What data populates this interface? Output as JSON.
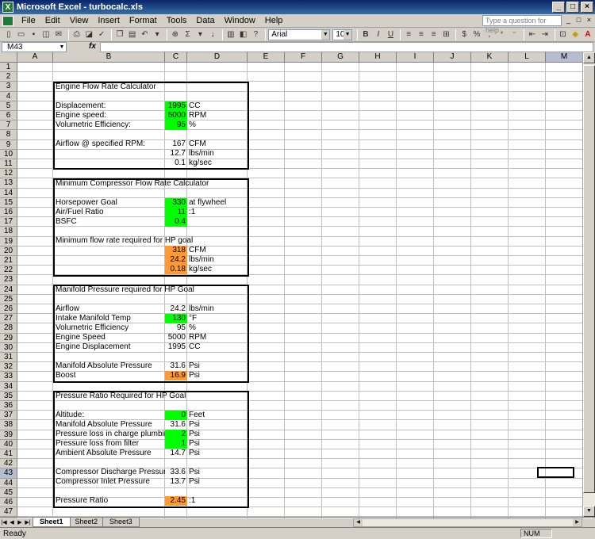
{
  "window": {
    "title": "Microsoft Excel - turbocalc.xls"
  },
  "menu": [
    "File",
    "Edit",
    "View",
    "Insert",
    "Format",
    "Tools",
    "Data",
    "Window",
    "Help"
  ],
  "help_placeholder": "Type a question for help",
  "toolbar": {
    "font_name": "Arial",
    "font_size": "10"
  },
  "namebox": "M43",
  "fx_label": "fx",
  "columns": [
    "A",
    "B",
    "C",
    "D",
    "E",
    "F",
    "G",
    "H",
    "I",
    "J",
    "K",
    "L",
    "M"
  ],
  "selected_column": "M",
  "selected_row": 43,
  "rows": [
    1,
    2,
    3,
    4,
    5,
    6,
    7,
    8,
    9,
    10,
    11,
    12,
    13,
    14,
    15,
    16,
    17,
    18,
    19,
    20,
    21,
    22,
    23,
    24,
    25,
    26,
    27,
    28,
    29,
    30,
    31,
    32,
    33,
    34,
    35,
    36,
    37,
    38,
    39,
    40,
    41,
    42,
    43,
    44,
    45,
    46,
    47
  ],
  "sections": {
    "engine": {
      "title": "Engine Flow Rate Calculator",
      "displacement": {
        "label": "Displacement:",
        "value": "1995",
        "unit": "CC"
      },
      "speed": {
        "label": "Engine speed:",
        "value": "5000",
        "unit": "RPM"
      },
      "ve": {
        "label": "Volumetric Efficiency:",
        "value": "95",
        "unit": "%"
      },
      "airflow": {
        "label": "Airflow  @ specified RPM:",
        "value": "167",
        "unit": "CFM"
      },
      "airflow_lbs": {
        "value": "12.7",
        "unit": "lbs/min"
      },
      "airflow_kg": {
        "value": "0.1",
        "unit": "kg/sec"
      }
    },
    "compressor": {
      "title": "Minimum Compressor Flow Rate Calculator",
      "hp_goal": {
        "label": "Horsepower Goal",
        "value": "330",
        "unit": "at flywheel"
      },
      "afr": {
        "label": "Air/Fuel Ratio",
        "value": "11",
        "unit": ":1"
      },
      "bsfc": {
        "label": "BSFC",
        "value": "0.4"
      },
      "min_flow_label": "Minimum flow rate required for HP goal",
      "cfm": {
        "value": "318",
        "unit": "CFM"
      },
      "lbs": {
        "value": "24.2",
        "unit": "lbs/min"
      },
      "kg": {
        "value": "0.18",
        "unit": "kg/sec"
      }
    },
    "manifold": {
      "title": "Manifold Pressure required for HP Goal",
      "airflow": {
        "label": "Airflow",
        "value": "24.2",
        "unit": "lbs/min"
      },
      "temp": {
        "label": "Intake Manifold Temp",
        "value": "130",
        "unit": "°F"
      },
      "ve": {
        "label": "Volumetric Efficiency",
        "value": "95",
        "unit": "%"
      },
      "speed": {
        "label": "Engine Speed",
        "value": "5000",
        "unit": "RPM"
      },
      "disp": {
        "label": "Engine Displacement",
        "value": "1995",
        "unit": "CC"
      },
      "map": {
        "label": "Manifold Absolute Pressure",
        "value": "31.6",
        "unit": "Psi"
      },
      "boost": {
        "label": "Boost",
        "value": "16.9",
        "unit": "Psi"
      }
    },
    "pressure": {
      "title": "Pressure Ratio Required for HP Goal",
      "altitude": {
        "label": "Altitude:",
        "value": "0",
        "unit": "Feet"
      },
      "map": {
        "label": "Manifold Absolute Pressure",
        "value": "31.6",
        "unit": "Psi"
      },
      "charge_loss": {
        "label": "Pressure loss in charge plumbing",
        "value": "2",
        "unit": "Psi"
      },
      "filter_loss": {
        "label": "Pressure loss from filter",
        "value": "1",
        "unit": "Psi"
      },
      "ambient": {
        "label": "Ambient Absolute Pressure",
        "value": "14.7",
        "unit": "Psi"
      },
      "discharge": {
        "label": "Compressor Discharge Pressure",
        "value": "33.6",
        "unit": "Psi"
      },
      "inlet": {
        "label": "Compressor Inlet Pressure",
        "value": "13.7",
        "unit": "Psi"
      },
      "ratio": {
        "label": "Pressure Ratio",
        "value": "2.45",
        "unit": ":1"
      }
    }
  },
  "sheets": [
    "Sheet1",
    "Sheet2",
    "Sheet3"
  ],
  "active_sheet": "Sheet1",
  "status": {
    "left": "Ready",
    "num": "NUM"
  },
  "colors": {
    "input_green": "#00ff00",
    "result_orange": "#ff9933",
    "selected_header": "#b6bdd2"
  }
}
